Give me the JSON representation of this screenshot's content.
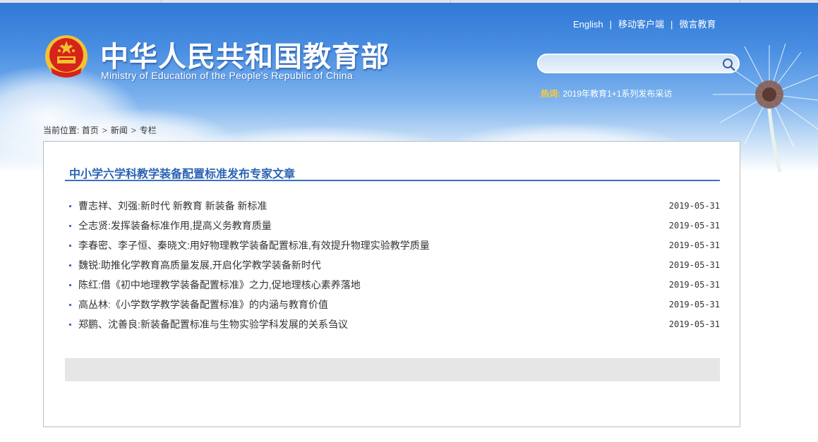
{
  "header": {
    "title_cn": "中华人民共和国教育部",
    "title_en": "Ministry of Education of the People's Republic of China",
    "top_links": [
      "English",
      "移动客户端",
      "微言教育"
    ],
    "search": {
      "value": "",
      "placeholder": ""
    },
    "hot": {
      "label": "热词:",
      "text": "2019年教育1+1系列发布采访"
    }
  },
  "breadcrumb": {
    "prefix": "当前位置:",
    "items": [
      "首页",
      "新闻",
      "专栏"
    ],
    "separator": ">"
  },
  "panel": {
    "title": "中小学六学科教学装备配置标准发布专家文章",
    "articles": [
      {
        "title": "曹志祥、刘强:新时代 新教育 新装备 新标准",
        "date": "2019-05-31"
      },
      {
        "title": "仝志贤:发挥装备标准作用,提高义务教育质量",
        "date": "2019-05-31"
      },
      {
        "title": "李春密、李子恒、秦晓文:用好物理教学装备配置标准,有效提升物理实验教学质量",
        "date": "2019-05-31"
      },
      {
        "title": "魏锐:助推化学教育高质量发展,开启化学教学装备新时代",
        "date": "2019-05-31"
      },
      {
        "title": "陈红:借《初中地理教学装备配置标准》之力,促地理核心素养落地",
        "date": "2019-05-31"
      },
      {
        "title": "高丛林:《小学数学教学装备配置标准》的内涵与教育价值",
        "date": "2019-05-31"
      },
      {
        "title": "郑鹏、沈善良:新装备配置标准与生物实验学科发展的关系刍议",
        "date": "2019-05-31"
      }
    ]
  },
  "icons": {
    "emblem": "national-emblem-icon",
    "search": "search-icon",
    "decor": "dandelion-decor"
  },
  "colors": {
    "header_blue": "#2f78d6",
    "title_blue": "#2b63b3",
    "rule_blue": "#3c6fbf",
    "hot_label": "#ffcc33",
    "emblem_red": "#d6231c",
    "emblem_gold": "#f2c230"
  }
}
